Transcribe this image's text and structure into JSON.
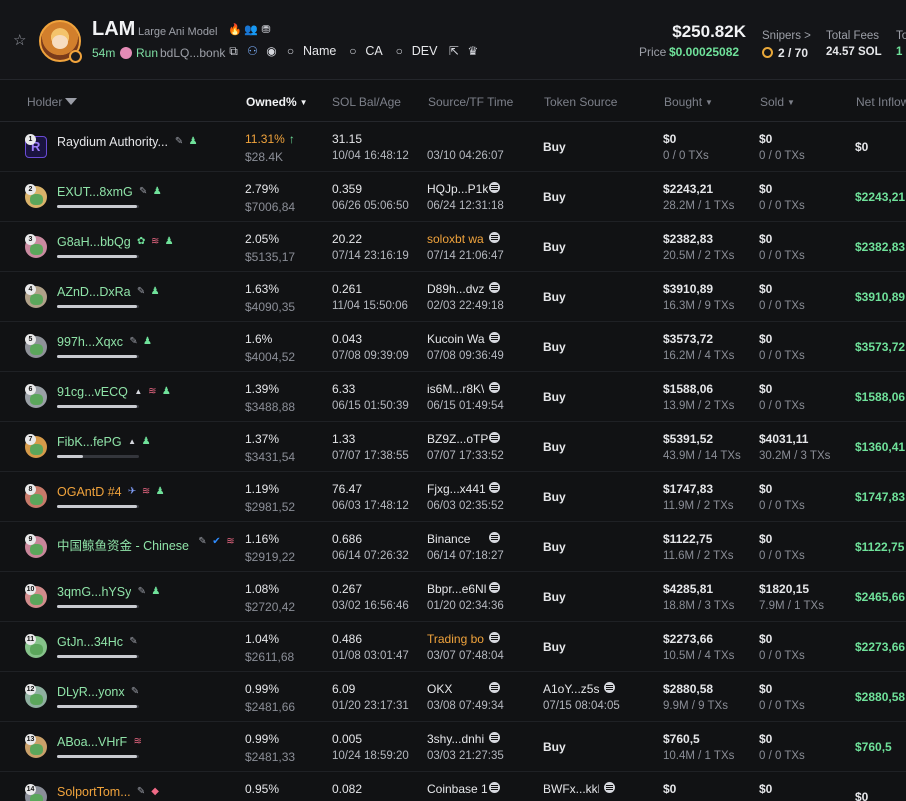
{
  "header": {
    "symbol": "LAM",
    "name": "Large Ani Model",
    "age": "54m",
    "run_label": "Run",
    "address": "bdLQ...bonk",
    "links": [
      {
        "label": "Name",
        "icon": "search-icon"
      },
      {
        "label": "CA",
        "icon": "search-icon"
      },
      {
        "label": "DEV",
        "icon": "search-icon"
      }
    ],
    "market_cap": "$250.82K",
    "price_label": "Price",
    "price": "$0.00025082",
    "snipers_label": "Snipers >",
    "snipers_value": "2 / 70",
    "total_fees_label": "Total Fees",
    "total_fees_value": "24.57 SOL",
    "clipped_label": "To",
    "clipped_value": "1"
  },
  "columns": {
    "holder": "Holder",
    "owned": "Owned%",
    "sol_bal": "SOL Bal/Age",
    "source_tf": "Source/TF Time",
    "token_source": "Token Source",
    "bought": "Bought",
    "sold": "Sold",
    "net_inflow": "Net Inflow"
  },
  "rows": [
    {
      "rank": "1",
      "name": "Raydium Authority...",
      "name_color": "white",
      "tags": [
        "edit",
        "user"
      ],
      "bar": null,
      "owned": "11.31%",
      "owned_up": true,
      "owned_usd": "$28.4K",
      "sol": "31.15",
      "age": "10/04 16:48:12",
      "source": "",
      "source_time": "03/10 04:26:07",
      "token_source": "Buy",
      "bought": "$0",
      "bought_sub": "0 / 0 TXs",
      "sold": "$0",
      "sold_sub": "0 / 0 TXs",
      "inflow": "$0",
      "inflow_color": "white"
    },
    {
      "rank": "2",
      "name": "EXUT...8xmG",
      "name_color": "green",
      "tags": [
        "edit",
        "user"
      ],
      "bar": 0.98,
      "owned": "2.79%",
      "owned_usd": "$7006,84",
      "sol": "0.359",
      "age": "06/26 05:06:50",
      "source": "HQJp...P1k",
      "source_time": "06/24 12:31:18",
      "token_source": "Buy",
      "bought": "$2243,21",
      "bought_sub": "28.2M / 1 TXs",
      "sold": "$0",
      "sold_sub": "0 / 0 TXs",
      "inflow": "$2243,21"
    },
    {
      "rank": "3",
      "name": "G8aH...bbQg",
      "name_color": "green",
      "tags": [
        "leaf",
        "stack",
        "user"
      ],
      "bar": 0.98,
      "owned": "2.05%",
      "owned_usd": "$5135,17",
      "sol": "20.22",
      "age": "07/14 23:16:19",
      "source": "soloxbt wa",
      "source_color": "orange",
      "source_time": "07/14 21:06:47",
      "token_source": "Buy",
      "bought": "$2382,83",
      "bought_sub": "20.5M / 2 TXs",
      "sold": "$0",
      "sold_sub": "0 / 0 TXs",
      "inflow": "$2382,83"
    },
    {
      "rank": "4",
      "name": "AZnD...DxRa",
      "name_color": "green",
      "tags": [
        "edit",
        "user"
      ],
      "bar": 0.98,
      "owned": "1.63%",
      "owned_usd": "$4090,35",
      "sol": "0.261",
      "age": "11/04 15:50:06",
      "source": "D89h...dvz",
      "source_time": "02/03 22:49:18",
      "token_source": "Buy",
      "bought": "$3910,89",
      "bought_sub": "16.3M / 9 TXs",
      "sold": "$0",
      "sold_sub": "0 / 0 TXs",
      "inflow": "$3910,89"
    },
    {
      "rank": "5",
      "name": "997h...Xqxc",
      "name_color": "green",
      "tags": [
        "edit",
        "user"
      ],
      "bar": 0.98,
      "owned": "1.6%",
      "owned_usd": "$4004,52",
      "sol": "0.043",
      "age": "07/08 09:39:09",
      "source": "Kucoin Wa",
      "source_time": "07/08 09:36:49",
      "token_source": "Buy",
      "bought": "$3573,72",
      "bought_sub": "16.2M / 4 TXs",
      "sold": "$0",
      "sold_sub": "0 / 0 TXs",
      "inflow": "$3573,72"
    },
    {
      "rank": "6",
      "name": "91cg...vECQ",
      "name_color": "green",
      "tags": [
        "tri",
        "stack",
        "user"
      ],
      "bar": 0.98,
      "owned": "1.39%",
      "owned_usd": "$3488,88",
      "sol": "6.33",
      "age": "06/15 01:50:39",
      "source": "is6M...r8K\\",
      "source_time": "06/15 01:49:54",
      "token_source": "Buy",
      "bought": "$1588,06",
      "bought_sub": "13.9M / 2 TXs",
      "sold": "$0",
      "sold_sub": "0 / 0 TXs",
      "inflow": "$1588,06"
    },
    {
      "rank": "7",
      "name": "FibK...fePG",
      "name_color": "green",
      "tags": [
        "tri",
        "user"
      ],
      "bar": 0.32,
      "owned": "1.37%",
      "owned_usd": "$3431,54",
      "sol": "1.33",
      "age": "07/07 17:38:55",
      "source": "BZ9Z...oTP",
      "source_time": "07/07 17:33:52",
      "token_source": "Buy",
      "bought": "$5391,52",
      "bought_sub": "43.9M / 14 TXs",
      "sold": "$4031,11",
      "sold_sub": "30.2M / 3 TXs",
      "inflow": "$1360,41"
    },
    {
      "rank": "8",
      "name": "OGAntD #4",
      "name_color": "orange",
      "tags": [
        "rocket",
        "stack",
        "user"
      ],
      "bar": 0.98,
      "owned": "1.19%",
      "owned_usd": "$2981,52",
      "sol": "76.47",
      "age": "06/03 17:48:12",
      "source": "Fjxg...x441",
      "source_time": "06/03 02:35:52",
      "token_source": "Buy",
      "bought": "$1747,83",
      "bought_sub": "11.9M / 2 TXs",
      "sold": "$0",
      "sold_sub": "0 / 0 TXs",
      "inflow": "$1747,83"
    },
    {
      "rank": "9",
      "name": "中国鲸鱼资金 - Chinese ...",
      "name_color": "green",
      "tags": [
        "edit",
        "verify",
        "stack"
      ],
      "bar": null,
      "owned": "1.16%",
      "owned_usd": "$2919,22",
      "sol": "0.686",
      "age": "06/14 07:26:32",
      "source": "Binance",
      "source_time": "06/14 07:18:27",
      "token_source": "Buy",
      "bought": "$1122,75",
      "bought_sub": "11.6M / 2 TXs",
      "sold": "$0",
      "sold_sub": "0 / 0 TXs",
      "inflow": "$1122,75"
    },
    {
      "rank": "10",
      "name": "3qmG...hYSy",
      "name_color": "green",
      "tags": [
        "edit",
        "user"
      ],
      "bar": 0.98,
      "owned": "1.08%",
      "owned_usd": "$2720,42",
      "sol": "0.267",
      "age": "03/02 16:56:46",
      "source": "Bbpr...e6Nl",
      "source_time": "01/20 02:34:36",
      "token_source": "Buy",
      "bought": "$4285,81",
      "bought_sub": "18.8M / 3 TXs",
      "sold": "$1820,15",
      "sold_sub": "7.9M / 1 TXs",
      "inflow": "$2465,66"
    },
    {
      "rank": "11",
      "name": "GtJn...34Hc",
      "name_color": "green",
      "tags": [
        "edit"
      ],
      "bar": 0.98,
      "owned": "1.04%",
      "owned_usd": "$2611,68",
      "sol": "0.486",
      "age": "01/08 03:01:47",
      "source": "Trading bo",
      "source_color": "orange",
      "source_time": "03/07 07:48:04",
      "token_source": "Buy",
      "bought": "$2273,66",
      "bought_sub": "10.5M / 4 TXs",
      "sold": "$0",
      "sold_sub": "0 / 0 TXs",
      "inflow": "$2273,66"
    },
    {
      "rank": "12",
      "name": "DLyR...yonx",
      "name_color": "green",
      "tags": [
        "edit"
      ],
      "bar": 0.98,
      "owned": "0.99%",
      "owned_usd": "$2481,66",
      "sol": "6.09",
      "age": "01/20 23:17:31",
      "source": "OKX",
      "source_time": "03/08 07:49:34",
      "token_source": "A1oY...z5s",
      "token_source_time": "07/15 08:04:05",
      "bought": "$2880,58",
      "bought_sub": "9.9M / 9 TXs",
      "sold": "$0",
      "sold_sub": "0 / 0 TXs",
      "inflow": "$2880,58"
    },
    {
      "rank": "13",
      "name": "ABoa...VHrF",
      "name_color": "green",
      "tags": [
        "stack"
      ],
      "bar": 0.98,
      "owned": "0.99%",
      "owned_usd": "$2481,33",
      "sol": "0.005",
      "age": "10/24 18:59:20",
      "source": "3shy...dnhi",
      "source_time": "03/03 21:27:35",
      "token_source": "Buy",
      "bought": "$760,5",
      "bought_sub": "10.4M / 1 TXs",
      "sold": "$0",
      "sold_sub": "0 / 0 TXs",
      "inflow": "$760,5"
    },
    {
      "rank": "14",
      "name": "SolportTom...",
      "name_color": "orange",
      "tags": [
        "edit",
        "tag-red"
      ],
      "bar": null,
      "owned": "0.95%",
      "owned_usd": "",
      "sol": "0.082",
      "age": "",
      "source": "Coinbase 1",
      "source_time": "",
      "token_source": "BWFx...kkk",
      "bought": "$0",
      "bought_sub": "",
      "sold": "$0",
      "sold_sub": "",
      "inflow": "$0",
      "inflow_color": "white"
    }
  ]
}
